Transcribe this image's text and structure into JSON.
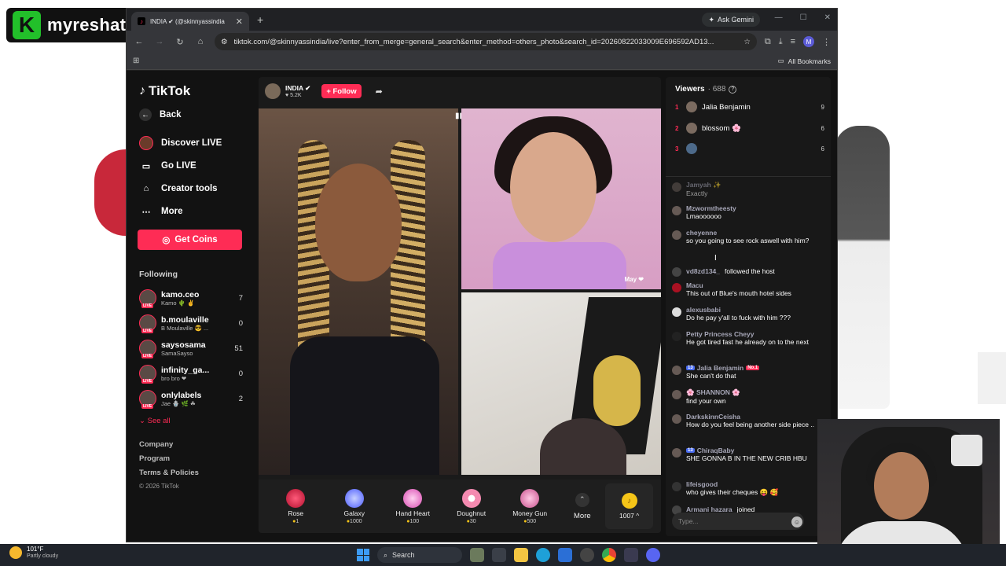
{
  "overlay": {
    "brand_letter": "K",
    "brand_name": "myreshatv"
  },
  "browser": {
    "tab_title": "INDIA ✔ (@skinnyassindia",
    "ask_gemini": "Ask Gemini",
    "url": "tiktok.com/@skinnyassindia/live?enter_from_merge=general_search&enter_method=others_photo&search_id=20260822033009E696592AD13...",
    "all_bookmarks": "All Bookmarks",
    "profile_initial": "M"
  },
  "tiktok": {
    "logo": "TikTok",
    "nav": {
      "back": "Back",
      "discover_live": "Discover LIVE",
      "go_live": "Go LIVE",
      "creator_tools": "Creator tools",
      "more": "More"
    },
    "get_coins": "Get Coins",
    "following_heading": "Following",
    "following": [
      {
        "name": "kamo.ceo",
        "sub": "Kamo 🌵 ✌",
        "count": "7"
      },
      {
        "name": "b.moulaville",
        "sub": "B Moulaville 😎 ...",
        "count": "0"
      },
      {
        "name": "saysosama",
        "sub": "SamaSayso",
        "count": "51"
      },
      {
        "name": "infinity_ga...",
        "sub": "bro bro ❤",
        "count": "0"
      },
      {
        "name": "onlylabels",
        "sub": "Jae 🪬 🌿 ☘",
        "count": "2"
      }
    ],
    "see_all": "See all",
    "footer": {
      "company": "Company",
      "program": "Program",
      "terms": "Terms & Policies",
      "copyright": "© 2026 TikTok"
    }
  },
  "live": {
    "host_name": "INDIA ✔",
    "host_likes": "♥ 5.2K",
    "follow_label": "+ Follow",
    "guest_tag": "May ❤",
    "gifts": [
      {
        "name": "Rose",
        "price": "1",
        "color": "#e8204a"
      },
      {
        "name": "Galaxy",
        "price": "1000",
        "color": "#7b8bff"
      },
      {
        "name": "Hand Heart",
        "price": "100",
        "color": "#f07ad0"
      },
      {
        "name": "Doughnut",
        "price": "30",
        "color": "#f4a0c0"
      },
      {
        "name": "Money Gun",
        "price": "500",
        "color": "#e87ab8"
      }
    ],
    "more_label": "More",
    "coin_balance": "1007 ^"
  },
  "chat": {
    "viewers_label": "Viewers",
    "viewers_count": "· 688",
    "top_viewers": [
      {
        "rank": "1",
        "name": "Jalia Benjamin",
        "score": "9"
      },
      {
        "rank": "2",
        "name": "blossom 🌸",
        "score": "6"
      },
      {
        "rank": "3",
        "name": "",
        "score": "6"
      }
    ],
    "messages": [
      {
        "user": "Jamyah ✨",
        "text": "Exactly",
        "faded": true
      },
      {
        "user": "Mzwormtheesty",
        "text": "Lmaoooooo"
      },
      {
        "user": "cheyenne",
        "text": "so you going to see rock aswell with him?"
      },
      {
        "user": "Macu",
        "text": "This out of Blue's mouth hotel sides"
      },
      {
        "user": "alexusbabi",
        "text": "Do he pay y'all to fuck with him ???"
      },
      {
        "user": "Petty Princess Cheyy",
        "text": "He got tired fast he already on to the next"
      },
      {
        "user": "Jalia Benjamin",
        "text": "She can't do that",
        "badge": "13",
        "badge2": "No.1"
      },
      {
        "user": "🌸 SHANNON 🌸",
        "text": "find your own"
      },
      {
        "user": "DarkskinnCeisha",
        "text": "How do you feel being another side piece .."
      },
      {
        "user": "ChiraqBaby",
        "text": "SHE GONNA B IN THE NEW CRIB HBU",
        "badge": "13"
      },
      {
        "user": "lifeisgood",
        "text": "who gives their cheques 😝 🥰"
      }
    ],
    "followed": {
      "user": "vd8zd134_",
      "text": "followed the host"
    },
    "joined": {
      "user": "Armani hazara",
      "text": "joined"
    },
    "input_placeholder": "Type..."
  },
  "taskbar": {
    "temp": "101°F",
    "condition": "Partly cloudy",
    "search": "Search"
  }
}
